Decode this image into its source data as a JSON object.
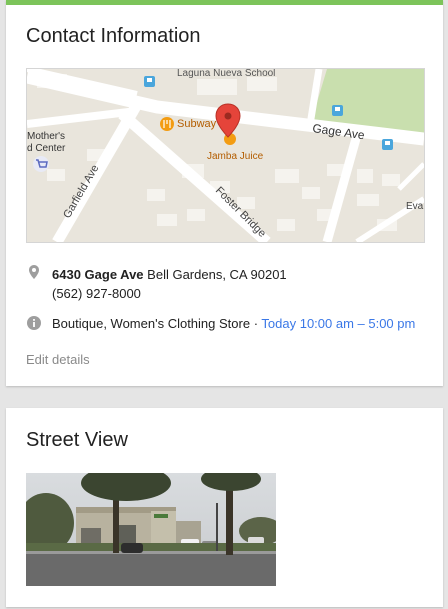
{
  "contact": {
    "title": "Contact Information",
    "map": {
      "school_label": "Laguna Nueva School",
      "mothers_center_label": "Mother's\nd Center",
      "subway_label": "Subway",
      "jamba_label": "Jamba Juice",
      "gage_ave_label": "Gage Ave",
      "garfield_label": "Garfield Ave",
      "foster_label": "Foster Bridge",
      "eva_label": "Eva"
    },
    "address_street": "6430 Gage Ave",
    "address_city": "Bell Gardens, CA 90201",
    "phone": "(562) 927-8000",
    "category": "Boutique, Women's Clothing Store",
    "separator": " · ",
    "hours": "Today 10:00 am – 5:00 pm",
    "edit_label": "Edit details"
  },
  "street_view": {
    "title": "Street View"
  },
  "colors": {
    "accent": "#7cc45a",
    "link": "#3b78e7",
    "pin": "#e5443a"
  }
}
